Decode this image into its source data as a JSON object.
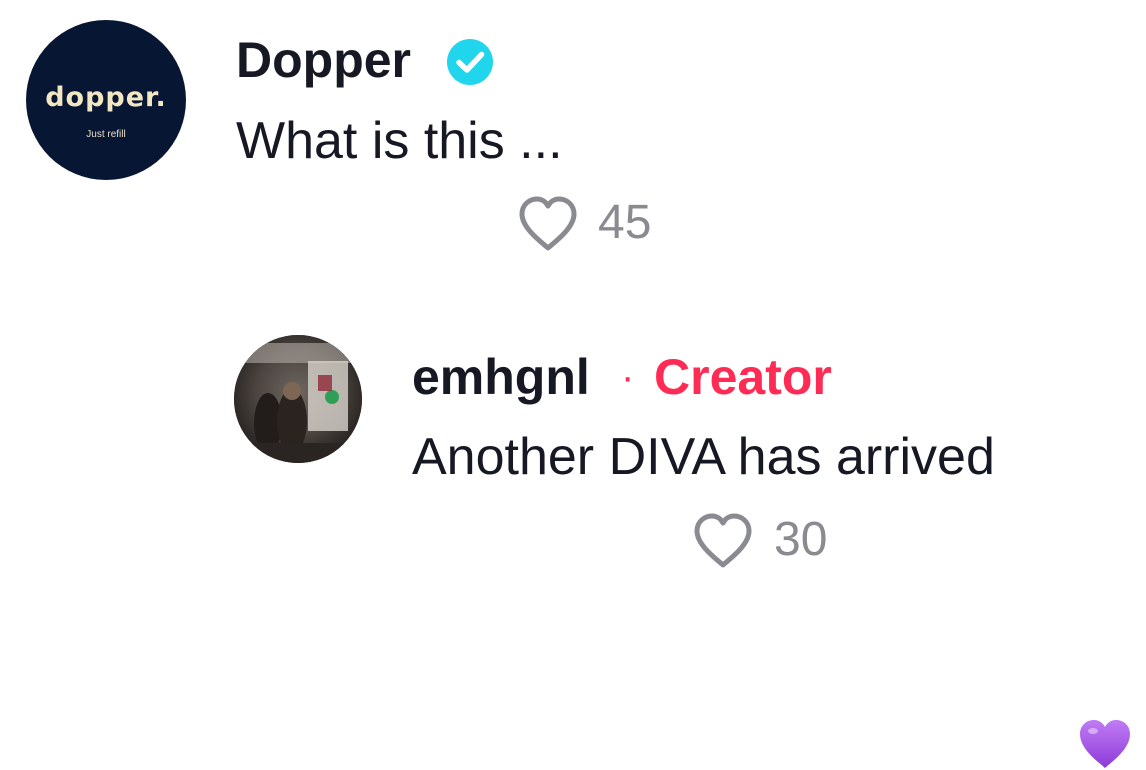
{
  "comments": [
    {
      "avatar": {
        "brand": "dopper.",
        "tagline": "Just refill"
      },
      "username": "Dopper",
      "verified": true,
      "text": "What is this ...",
      "likes": "45"
    },
    {
      "username": "emhgnl",
      "separator": "·",
      "role": "Creator",
      "text": "Another DIVA has arrived",
      "emoji": "purple-heart",
      "likes": "30"
    }
  ],
  "colors": {
    "text": "#161823",
    "creator": "#fe2c55",
    "verified": "#20d5ec",
    "muted": "#8a8b91",
    "purple_heart": "#a64de8"
  }
}
